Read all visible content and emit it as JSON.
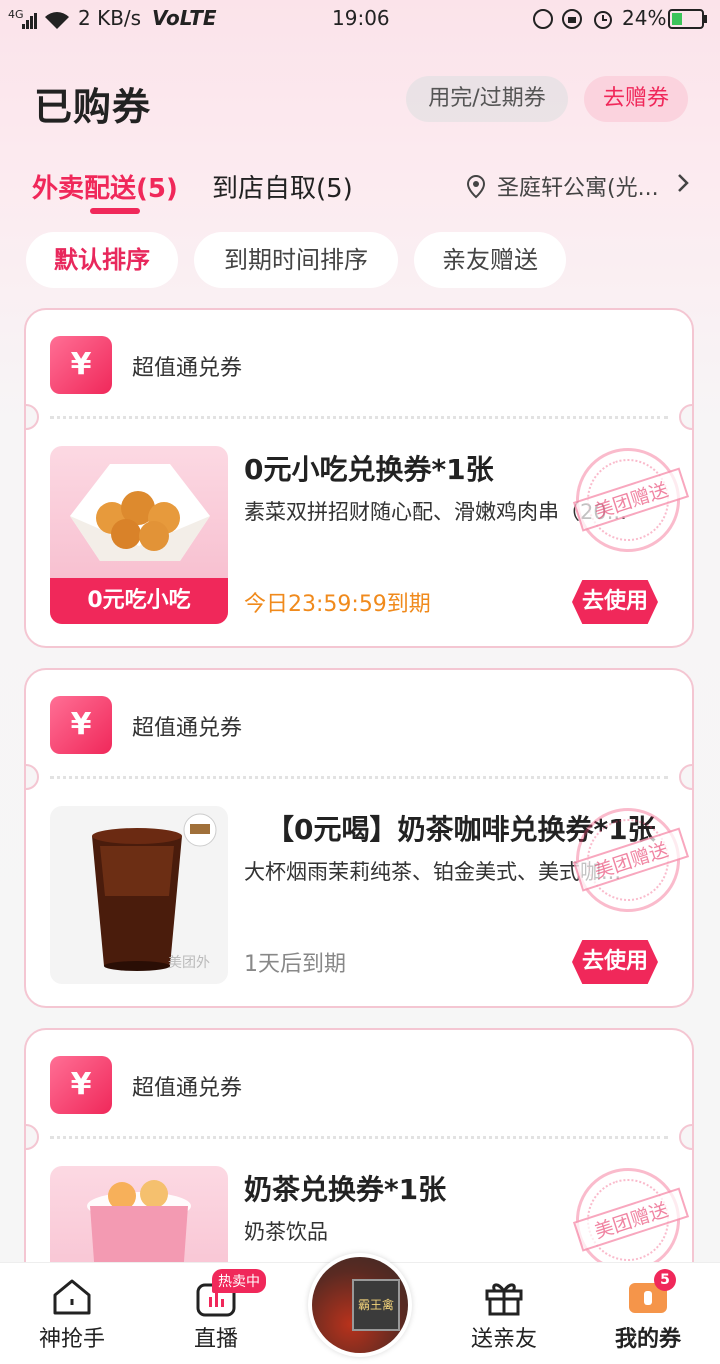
{
  "status_bar": {
    "network": "4G",
    "speed": "2 KB/s",
    "volte": "VoLTE",
    "time": "19:06",
    "battery": "24%"
  },
  "header": {
    "title": "已购券",
    "expired_button": "用完/过期券",
    "gift_button": "去赠券"
  },
  "tabs": [
    {
      "label": "外卖配送(5)",
      "active": true
    },
    {
      "label": "到店自取(5)",
      "active": false
    }
  ],
  "location": "圣庭轩公寓(光...",
  "sort_options": [
    {
      "label": "默认排序",
      "active": true
    },
    {
      "label": "到期时间排序",
      "active": false
    },
    {
      "label": "亲友赠送",
      "active": false
    }
  ],
  "coupons": [
    {
      "type": "超值通兑券",
      "title": "0元小吃兑换券*1张",
      "desc": "素菜双拼招财随心配、滑嫩鸡肉串（20...",
      "thumb_label": "0元吃小吃",
      "expiry": "今日23:59:59到期",
      "expiry_color": "#f08a1c",
      "button": "去使用",
      "stamp": "美团赠送"
    },
    {
      "type": "超值通兑券",
      "title": "【0元喝】奶茶咖啡兑换券*1张",
      "desc": "大杯烟雨茉莉纯茶、铂金美式、美式咖...",
      "thumb_watermark": "美团外",
      "expiry": "1天后到期",
      "expiry_color": "#888888",
      "button": "去使用",
      "stamp": "美团赠送"
    },
    {
      "type": "超值通兑券",
      "title": "奶茶兑换券*1张",
      "desc": "奶茶饮品",
      "stamp": "美团赠送"
    }
  ],
  "bottom_nav": {
    "items": [
      {
        "label": "神抢手",
        "icon": "home-icon"
      },
      {
        "label": "直播",
        "icon": "live-icon",
        "badge": "热卖中"
      },
      {
        "label": "送亲友",
        "icon": "gift-icon"
      },
      {
        "label": "我的券",
        "icon": "coupon-icon",
        "badge": "5",
        "active": true
      }
    ],
    "center_image_text": "霸王禽"
  },
  "colors": {
    "accent": "#f0285a",
    "warning": "#f08a1c"
  }
}
